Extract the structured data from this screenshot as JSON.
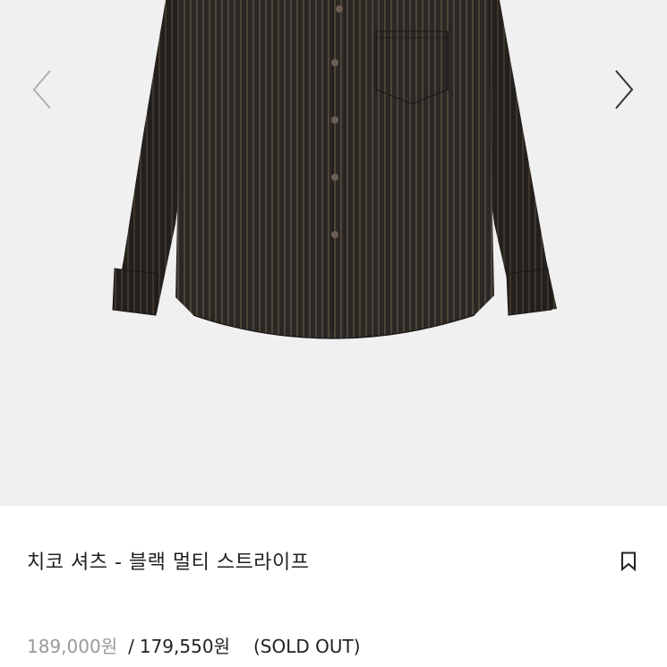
{
  "gallery": {
    "prev_icon": "chevron-left-icon",
    "next_icon": "chevron-right-icon",
    "image_subject": "black-multi-stripe-shirt",
    "colors": {
      "background": "#f0f0f0",
      "shirt": "#2b2724",
      "stripe": "#8a7a62",
      "button": "#6e5f55",
      "arrow_prev": "#b0b0b0",
      "arrow_next": "#333333"
    }
  },
  "product": {
    "title": "치코 셔츠 - 블랙 멀티 스트라이프",
    "bookmark_icon": "bookmark-icon",
    "original_price": "189,000원",
    "separator": "/",
    "sale_price": "179,550원",
    "status": "(SOLD OUT)"
  }
}
